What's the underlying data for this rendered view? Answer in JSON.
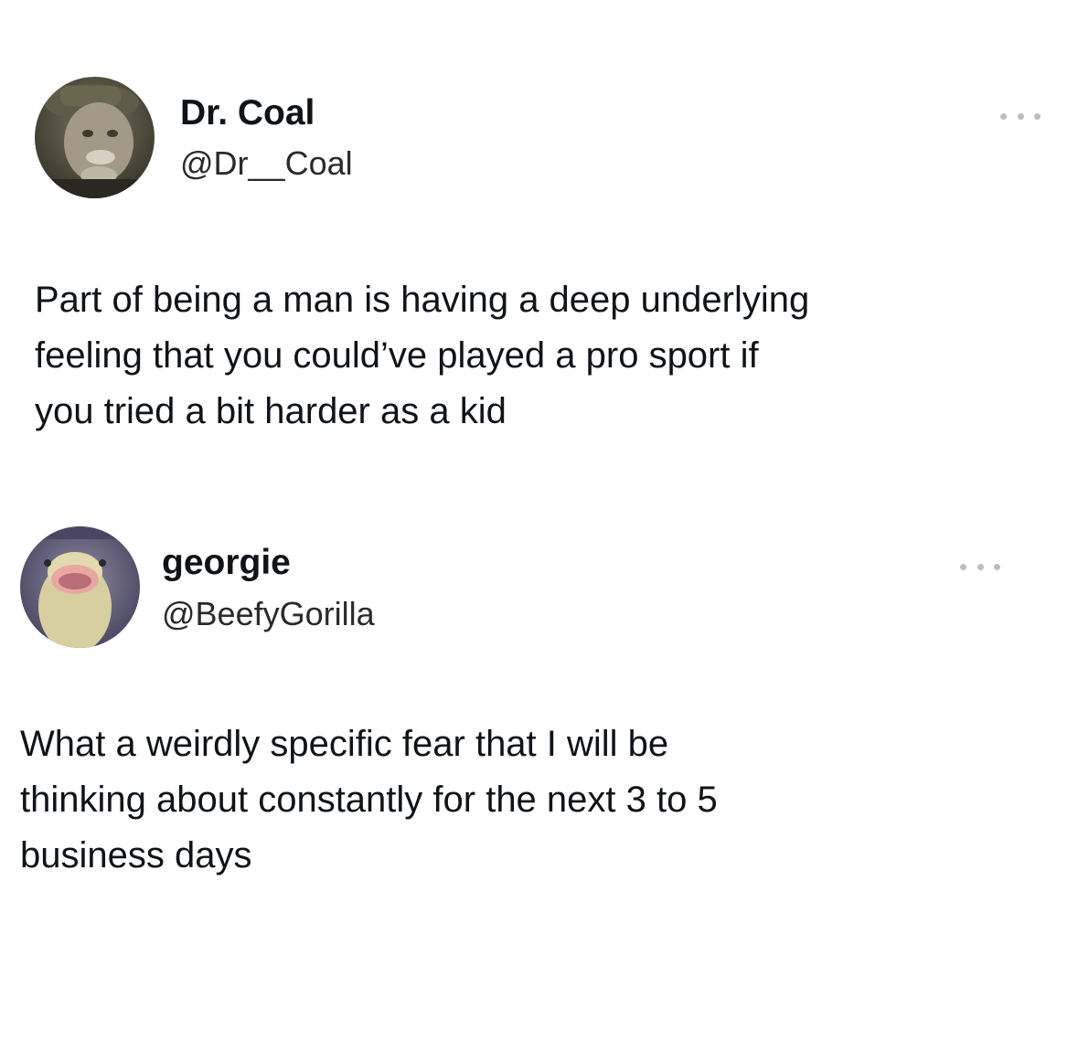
{
  "tweets": [
    {
      "author": {
        "display_name": "Dr. Coal",
        "handle": "@Dr__Coal",
        "avatar_icon": "avatar-photo-older-man"
      },
      "text": "Part of being a man is having a deep underlying\nfeeling that you could’ve played a pro sport if\nyou tried a bit harder as a kid",
      "more_icon": "more-horizontal-icon"
    },
    {
      "author": {
        "display_name": "georgie",
        "handle": "@BeefyGorilla",
        "avatar_icon": "avatar-photo-duck"
      },
      "text": "What a weirdly specific fear that I will be\nthinking about constantly for the next 3 to 5\nbusiness days",
      "more_icon": "more-horizontal-icon"
    }
  ],
  "colors": {
    "background": "#ffffff",
    "text": "#0f1419",
    "handle": "#2a2a2a",
    "more_dots": "#b9bec4"
  }
}
